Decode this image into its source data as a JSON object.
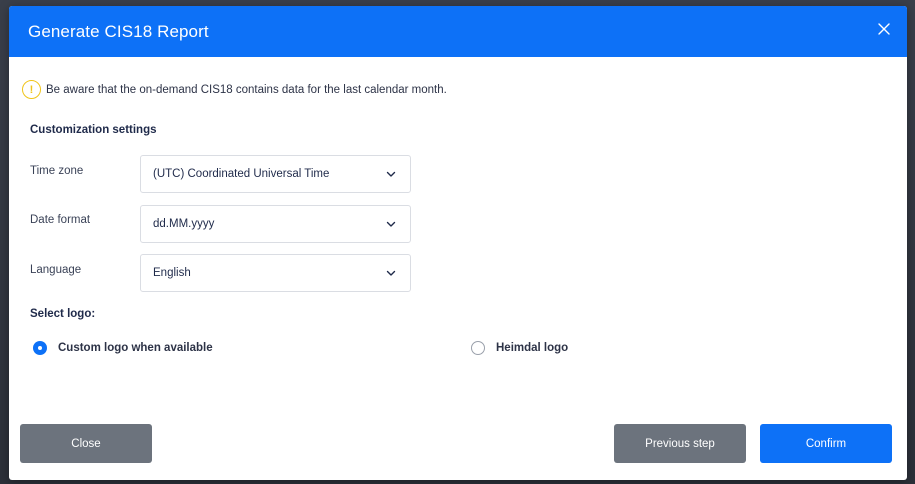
{
  "modal": {
    "title": "Generate CIS18 Report",
    "close_icon": "close-icon"
  },
  "notice": {
    "icon": "warning-icon",
    "icon_glyph": "!",
    "text": "Be aware that the on-demand CIS18 contains data for the last calendar month."
  },
  "customization": {
    "title": "Customization settings",
    "fields": [
      {
        "label": "Time zone",
        "value": "(UTC) Coordinated Universal Time"
      },
      {
        "label": "Date format",
        "value": "dd.MM.yyyy"
      },
      {
        "label": "Language",
        "value": "English"
      }
    ]
  },
  "logo": {
    "title": "Select logo:",
    "options": [
      {
        "label": "Custom logo when available",
        "selected": true
      },
      {
        "label": "Heimdal logo",
        "selected": false
      }
    ]
  },
  "footer": {
    "close_label": "Close",
    "previous_label": "Previous step",
    "confirm_label": "Confirm"
  },
  "colors": {
    "accent": "#0d71f7",
    "warning": "#f0c419",
    "secondary_button": "#6c737d"
  }
}
